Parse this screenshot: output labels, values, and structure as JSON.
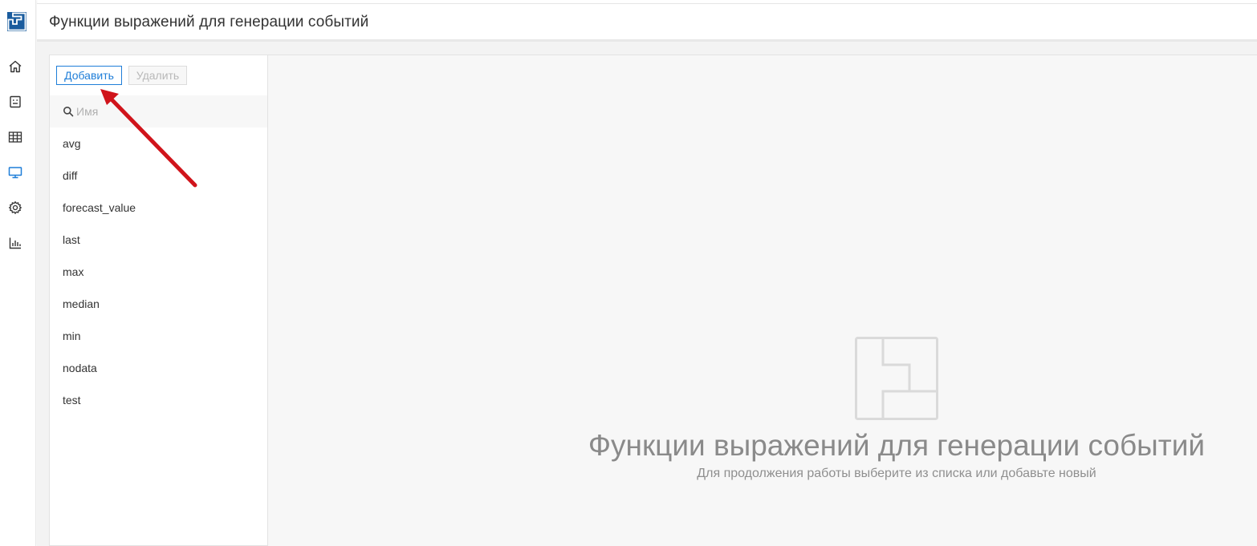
{
  "header": {
    "title": "Функции выражений для генерации событий"
  },
  "sidebar": {
    "logo_icon": "app-logo-icon",
    "items": [
      {
        "icon": "home-icon"
      },
      {
        "icon": "robot-icon"
      },
      {
        "icon": "table-icon"
      },
      {
        "icon": "monitor-icon",
        "active": true
      },
      {
        "icon": "gear-icon"
      },
      {
        "icon": "bar-chart-icon"
      }
    ]
  },
  "toolbar": {
    "add_label": "Добавить",
    "delete_label": "Удалить"
  },
  "search": {
    "placeholder": "Имя",
    "value": ""
  },
  "functions": [
    "avg",
    "diff",
    "forecast_value",
    "last",
    "max",
    "median",
    "min",
    "nodata",
    "test"
  ],
  "empty_state": {
    "title": "Функции выражений для генерации событий",
    "subtitle": "Для продолжения работы выберите из списка или добавьте новый"
  },
  "colors": {
    "accent": "#1f7ed8",
    "logo": "#1a5c9e",
    "arrow": "#d0141b",
    "text_muted": "#8a8a8a"
  }
}
